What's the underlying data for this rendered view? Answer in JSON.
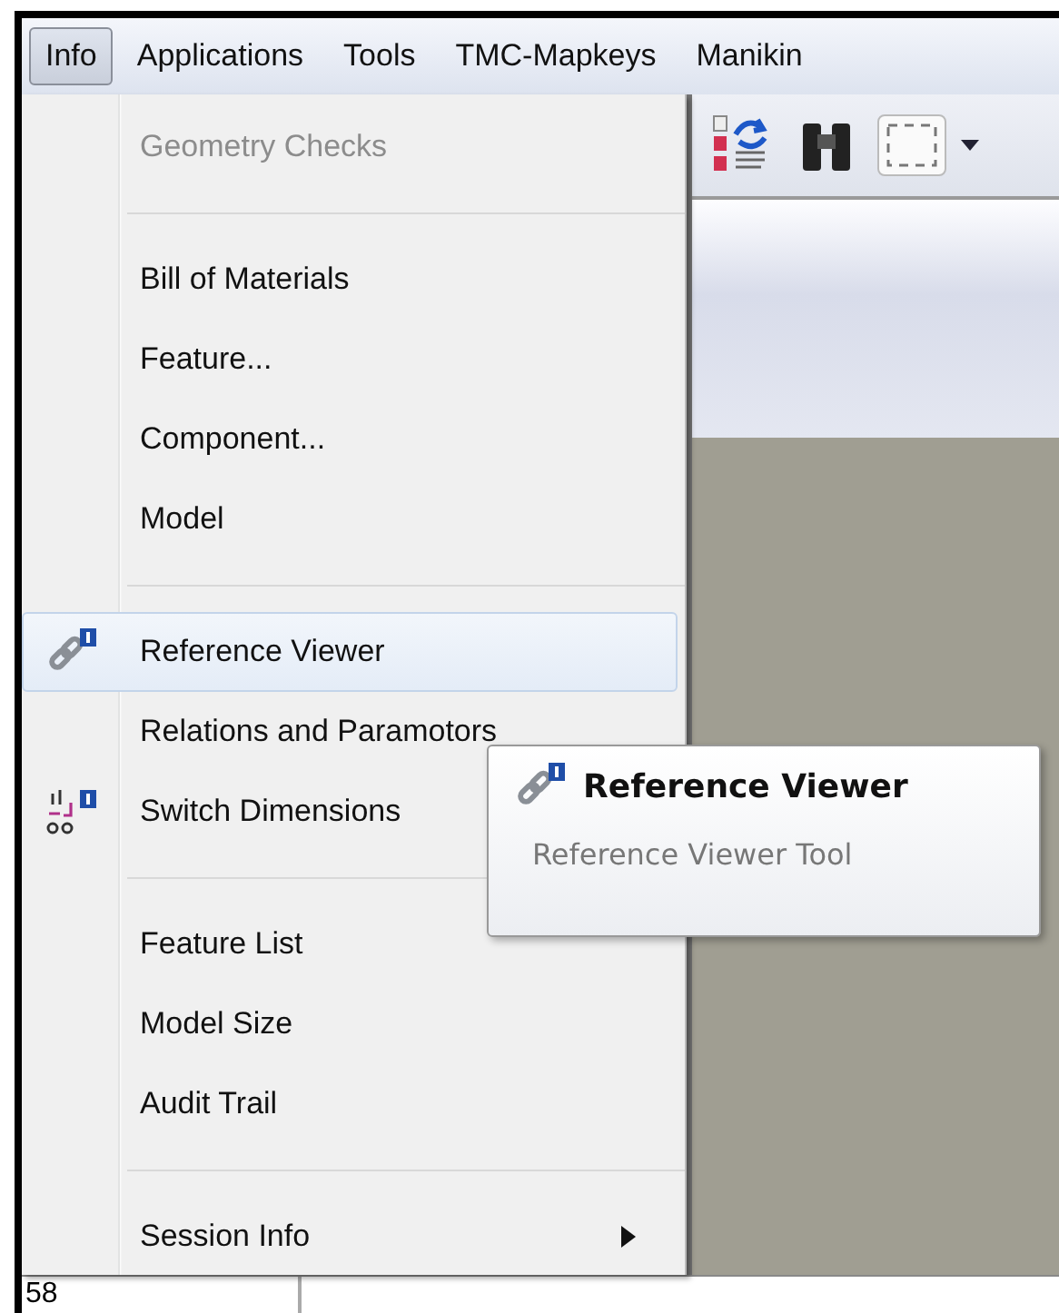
{
  "menubar": [
    {
      "label": "Info",
      "selected": true
    },
    {
      "label": "Applications",
      "selected": false
    },
    {
      "label": "Tools",
      "selected": false
    },
    {
      "label": "TMC-Mapkeys",
      "selected": false
    },
    {
      "label": "Manikin",
      "selected": false
    }
  ],
  "menu": [
    {
      "kind": "item",
      "label": "Geometry Checks",
      "disabled": true,
      "selected": false
    },
    {
      "kind": "separator"
    },
    {
      "kind": "item",
      "label": "Bill of Materials",
      "disabled": false,
      "selected": false
    },
    {
      "kind": "item",
      "label": "Feature...",
      "disabled": false,
      "selected": false
    },
    {
      "kind": "item",
      "label": "Component...",
      "disabled": false,
      "selected": false
    },
    {
      "kind": "item",
      "label": "Model",
      "disabled": false,
      "selected": false
    },
    {
      "kind": "separator"
    },
    {
      "kind": "item",
      "label": "Reference Viewer",
      "disabled": false,
      "selected": true
    },
    {
      "kind": "item",
      "label": "Relations and Paramotors",
      "disabled": false,
      "selected": false
    },
    {
      "kind": "item",
      "label": "Switch Dimensions",
      "disabled": false,
      "selected": false
    },
    {
      "kind": "separator"
    },
    {
      "kind": "item",
      "label": "Feature List",
      "disabled": false,
      "selected": false
    },
    {
      "kind": "item",
      "label": "Model Size",
      "disabled": false,
      "selected": false
    },
    {
      "kind": "item",
      "label": "Audit Trail",
      "disabled": false,
      "selected": false
    },
    {
      "kind": "separator"
    },
    {
      "kind": "submenu",
      "label": "Session Info",
      "disabled": false,
      "selected": false
    }
  ],
  "tooltip": {
    "title": "Reference Viewer",
    "description": "Reference Viewer Tool"
  },
  "status_field": {
    "value": "58"
  }
}
